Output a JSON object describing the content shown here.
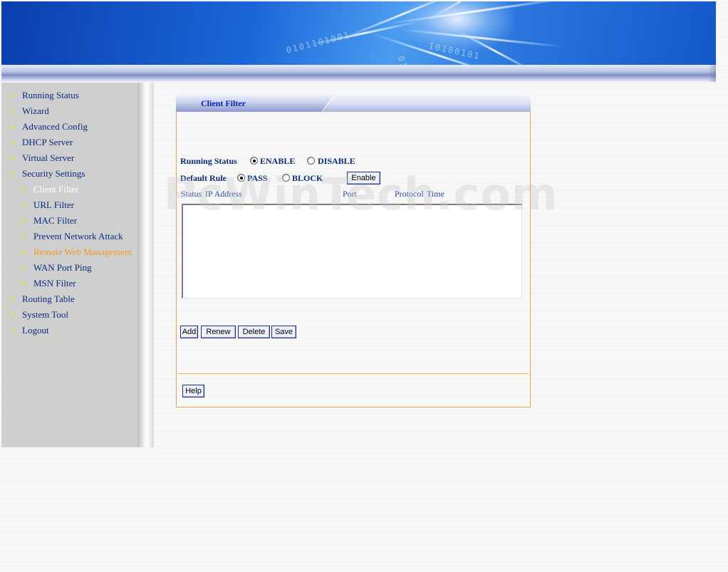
{
  "sidebar": {
    "items": [
      {
        "label": "Running Status",
        "level": 1,
        "state": "normal"
      },
      {
        "label": "Wizard",
        "level": 1,
        "state": "normal"
      },
      {
        "label": "Advanced Config",
        "level": 1,
        "state": "normal"
      },
      {
        "label": "DHCP Server",
        "level": 1,
        "state": "normal"
      },
      {
        "label": "Virtual Server",
        "level": 1,
        "state": "normal"
      },
      {
        "label": "Security Settings",
        "level": 1,
        "state": "normal"
      },
      {
        "label": "Client Filter",
        "level": 2,
        "state": "active"
      },
      {
        "label": "URL Filter",
        "level": 2,
        "state": "normal"
      },
      {
        "label": "MAC Filter",
        "level": 2,
        "state": "normal"
      },
      {
        "label": "Prevent Network Attack",
        "level": 2,
        "state": "normal"
      },
      {
        "label": "Remote Web Management",
        "level": 2,
        "state": "highlight"
      },
      {
        "label": "WAN Port Ping",
        "level": 2,
        "state": "normal"
      },
      {
        "label": "MSN Filter",
        "level": 2,
        "state": "normal"
      },
      {
        "label": "Routing Table",
        "level": 1,
        "state": "normal"
      },
      {
        "label": "System Tool",
        "level": 1,
        "state": "normal"
      },
      {
        "label": "Logout",
        "level": 1,
        "state": "normal"
      }
    ],
    "bullet_icon": "sparkle-icon"
  },
  "panel": {
    "title": "Client Filter",
    "running_status": {
      "label": "Running Status",
      "options": [
        {
          "label": "ENABLE",
          "checked": true
        },
        {
          "label": "DISABLE",
          "checked": false
        }
      ]
    },
    "default_rule": {
      "label": "Default Rule",
      "options": [
        {
          "label": "PASS",
          "checked": true
        },
        {
          "label": "BLOCK",
          "checked": false
        }
      ],
      "enable_button": "Enable"
    },
    "columns": [
      "Status",
      "IP Address",
      "Port",
      "Protocol",
      "Time"
    ],
    "rows": [],
    "buttons": {
      "add": "Add",
      "renew": "Renew",
      "delete": "Delete",
      "save": "Save",
      "help": "Help"
    }
  },
  "watermark": "PcWinTech.com",
  "colors": {
    "nav_text": "#0b2c7a",
    "nav_highlight": "#f29a2a",
    "panel_border": "#f0a34a",
    "title_text": "#0a1fb5",
    "sidebar_bg": "#cfcfcf"
  }
}
